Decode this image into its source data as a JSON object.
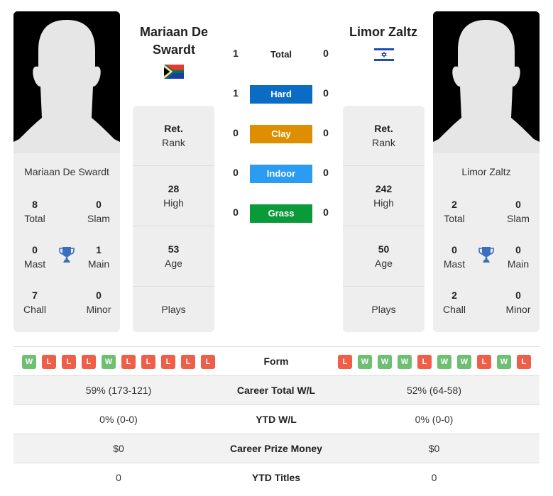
{
  "player1": {
    "name": "Mariaan De Swardt",
    "header_name_line1": "Mariaan De",
    "header_name_line2": "Swardt",
    "flag": "south-africa-flag",
    "stats": {
      "total": {
        "value": "8",
        "label": "Total"
      },
      "slam": {
        "value": "0",
        "label": "Slam"
      },
      "mast": {
        "value": "0",
        "label": "Mast"
      },
      "main": {
        "value": "1",
        "label": "Main"
      },
      "chall": {
        "value": "7",
        "label": "Chall"
      },
      "minor": {
        "value": "0",
        "label": "Minor"
      }
    },
    "info": {
      "rank": {
        "value": "Ret.",
        "label": "Rank"
      },
      "high": {
        "value": "28",
        "label": "High"
      },
      "age": {
        "value": "53",
        "label": "Age"
      },
      "plays": {
        "value": "",
        "label": "Plays"
      }
    },
    "form": [
      "W",
      "L",
      "L",
      "L",
      "W",
      "L",
      "L",
      "L",
      "L",
      "L"
    ],
    "career_total_wl": "59% (173-121)",
    "ytd_wl": "0% (0-0)",
    "career_prize_money": "$0",
    "ytd_titles": "0"
  },
  "player2": {
    "name": "Limor Zaltz",
    "header_name": "Limor Zaltz",
    "flag": "israel-flag",
    "stats": {
      "total": {
        "value": "2",
        "label": "Total"
      },
      "slam": {
        "value": "0",
        "label": "Slam"
      },
      "mast": {
        "value": "0",
        "label": "Mast"
      },
      "main": {
        "value": "0",
        "label": "Main"
      },
      "chall": {
        "value": "2",
        "label": "Chall"
      },
      "minor": {
        "value": "0",
        "label": "Minor"
      }
    },
    "info": {
      "rank": {
        "value": "Ret.",
        "label": "Rank"
      },
      "high": {
        "value": "242",
        "label": "High"
      },
      "age": {
        "value": "50",
        "label": "Age"
      },
      "plays": {
        "value": "",
        "label": "Plays"
      }
    },
    "form": [
      "L",
      "W",
      "W",
      "W",
      "L",
      "W",
      "W",
      "L",
      "W",
      "L"
    ],
    "career_total_wl": "52% (64-58)",
    "ytd_wl": "0% (0-0)",
    "career_prize_money": "$0",
    "ytd_titles": "0"
  },
  "h2h": [
    {
      "label": "Total",
      "p1": "1",
      "p2": "0",
      "color": ""
    },
    {
      "label": "Hard",
      "p1": "1",
      "p2": "0",
      "color": "#0a6cc4"
    },
    {
      "label": "Clay",
      "p1": "0",
      "p2": "0",
      "color": "#dd8f00"
    },
    {
      "label": "Indoor",
      "p1": "0",
      "p2": "0",
      "color": "#2b9cf2"
    },
    {
      "label": "Grass",
      "p1": "0",
      "p2": "0",
      "color": "#0a9a3a"
    }
  ],
  "table": {
    "form_label": "Form",
    "career_total_label": "Career Total W/L",
    "ytd_wl_label": "YTD W/L",
    "prize_label": "Career Prize Money",
    "ytd_titles_label": "YTD Titles"
  },
  "colors": {
    "win": "#6fbf73",
    "loss": "#ee5f4a",
    "trophy": "#3a6fbf"
  }
}
